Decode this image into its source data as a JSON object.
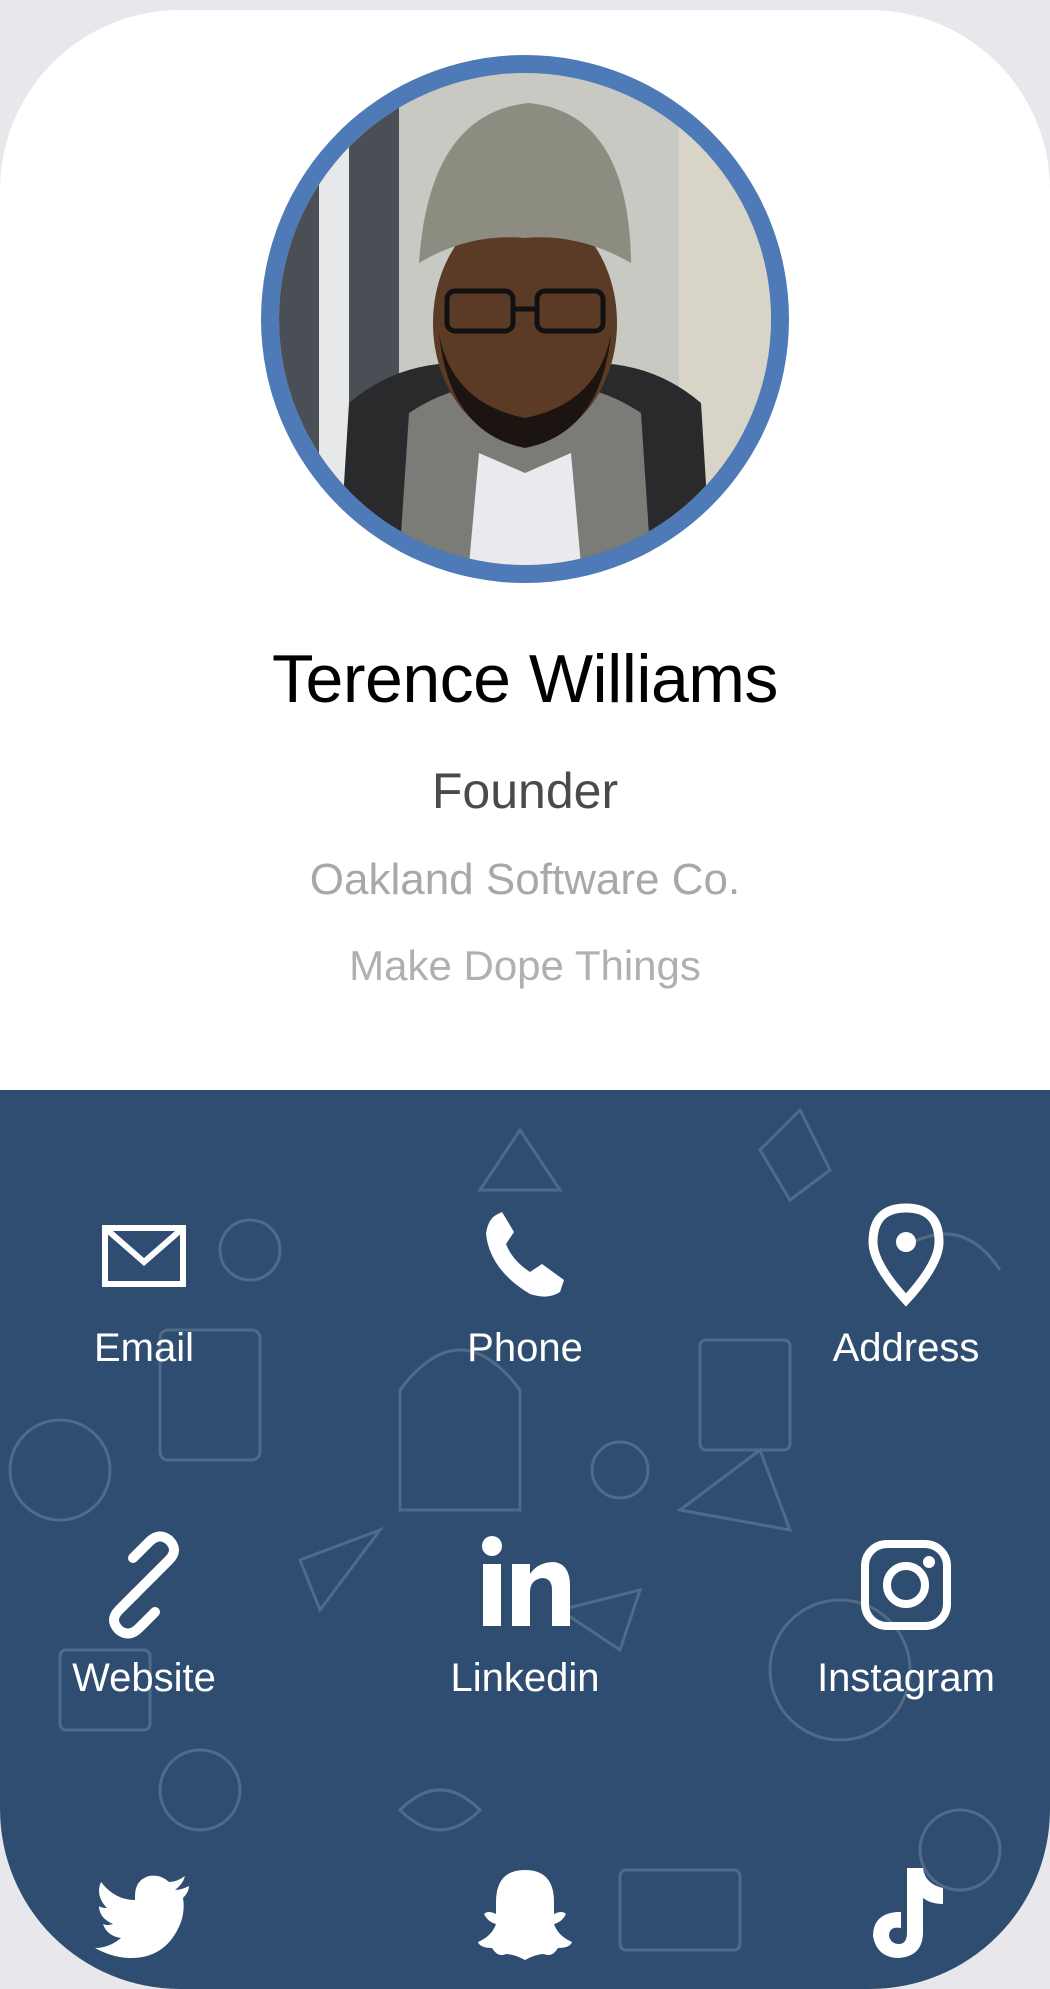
{
  "profile": {
    "name": "Terence Williams",
    "title": "Founder",
    "company": "Oakland Software Co.",
    "tagline": "Make Dope Things"
  },
  "colors": {
    "accent_ring": "#4e7bb8",
    "panel_bg": "#2f4d70",
    "name_text": "#000000",
    "muted_text": "#a8a8a8"
  },
  "links": [
    {
      "label": "Email",
      "icon": "envelope-icon"
    },
    {
      "label": "Phone",
      "icon": "phone-icon"
    },
    {
      "label": "Address",
      "icon": "map-pin-icon"
    },
    {
      "label": "Website",
      "icon": "link-icon"
    },
    {
      "label": "Linkedin",
      "icon": "linkedin-icon"
    },
    {
      "label": "Instagram",
      "icon": "instagram-icon"
    },
    {
      "label": "",
      "icon": "twitter-icon"
    },
    {
      "label": "",
      "icon": "snapchat-icon"
    },
    {
      "label": "",
      "icon": "tiktok-icon"
    }
  ]
}
